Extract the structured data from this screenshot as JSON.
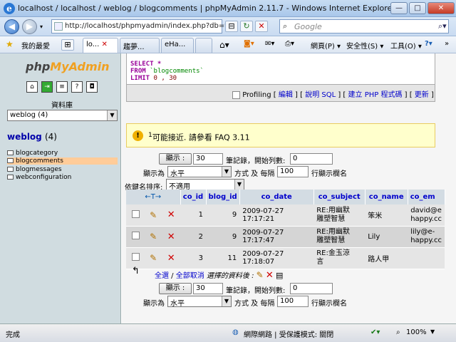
{
  "window": {
    "title": "localhost / localhost / weblog / blogcomments | phpMyAdmin 2.11.7 - Windows Internet Explorer",
    "min": "—",
    "max": "□",
    "close": "✕"
  },
  "address": {
    "url": "http://localhost/phpmyadmin/index.php?db=we",
    "search_placeholder": "Google"
  },
  "favbar": {
    "favorites": "我的最愛",
    "tabs": [
      "lo...",
      "趨夢...",
      "eHa..."
    ],
    "menus": [
      "網頁(P) ▾",
      "安全性(S) ▾",
      "工具(O) ▾"
    ]
  },
  "sidebar": {
    "logo_php": "php",
    "logo_myadmin": "MyAdmin",
    "db_label": "資料庫",
    "db_select": "weblog (4)",
    "db_name": "weblog",
    "db_count": "(4)",
    "tables": [
      "blogcategory",
      "blogcomments",
      "blogmessages",
      "webconfiguration"
    ]
  },
  "sql": {
    "line1": "SELECT *",
    "line2_kw": "FROM",
    "line2_tbl": "`blogcomments`",
    "line3_kw": "LIMIT",
    "line3_val": "0 , 30",
    "profiling": "Profiling",
    "links": [
      "編輯",
      "說明 SQL",
      "建立 PHP 程式碼",
      "更新"
    ]
  },
  "notice": {
    "sup": "1",
    "text": "可能接近. 請參看",
    "link": "FAQ 3.11"
  },
  "nav": {
    "show_btn": "顯示 :",
    "rows": "30",
    "rows_label": "筆記錄，開始列數:",
    "start": "0",
    "mode_label": "顯示為",
    "mode": "水平",
    "mode_suffix": "方式 及 每隔",
    "repeat": "100",
    "repeat_suffix": "行顯示欄名",
    "sort_label": "依鍵名排序:",
    "sort": "不適用"
  },
  "table": {
    "arrows": "←T→",
    "headers": [
      "co_id",
      "blog_id",
      "co_date",
      "co_subject",
      "co_name",
      "co_em"
    ],
    "rows": [
      {
        "co_id": "1",
        "blog_id": "9",
        "co_date": "2009-07-27 17:17:21",
        "subject1": "RE:用幽默",
        "subject2": "雕塑智慧",
        "name": "笨米",
        "email1": "david@e",
        "email2": "happy.cc"
      },
      {
        "co_id": "2",
        "blog_id": "9",
        "co_date": "2009-07-27 17:17:47",
        "subject1": "RE:用幽默",
        "subject2": "雕塑智慧",
        "name": "Lily",
        "email1": "lily@e-",
        "email2": "happy.cc"
      },
      {
        "co_id": "3",
        "blog_id": "11",
        "co_date": "2009-07-27 17:18:07",
        "subject1": "RE:金玉涼",
        "subject2": "言",
        "name": "路人甲",
        "email1": "",
        "email2": ""
      }
    ]
  },
  "footer_actions": {
    "check_all": "全選",
    "uncheck_all": "全部取消",
    "selected": "選擇的資料後 :"
  },
  "status": {
    "done": "完成",
    "zone": "網際網路 | 受保護模式: 關閉",
    "zoom": "100%"
  }
}
